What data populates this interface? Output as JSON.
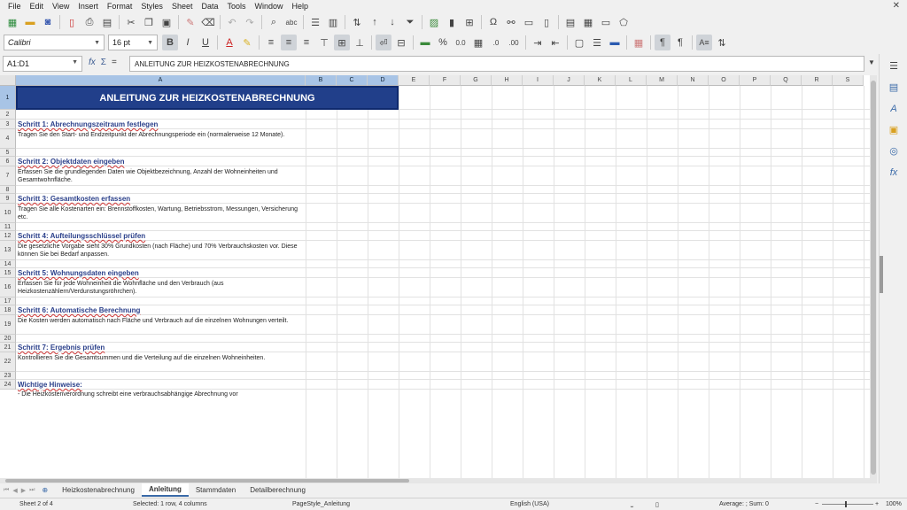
{
  "menu": [
    "File",
    "Edit",
    "View",
    "Insert",
    "Format",
    "Styles",
    "Sheet",
    "Data",
    "Tools",
    "Window",
    "Help"
  ],
  "font": {
    "name": "Calibri",
    "size": "16 pt"
  },
  "namebox": "A1:D1",
  "formula": "ANLEITUNG ZUR HEIZKOSTENABRECHNUNG",
  "columns": [
    "A",
    "B",
    "C",
    "D",
    "E",
    "F",
    "G",
    "H",
    "I",
    "J",
    "K",
    "L",
    "M",
    "N",
    "O",
    "P",
    "Q",
    "R",
    "S"
  ],
  "rows": [
    "1",
    "2",
    "3",
    "4",
    "5",
    "6",
    "7",
    "8",
    "9",
    "10",
    "11",
    "12",
    "13",
    "14",
    "15",
    "16",
    "17",
    "18",
    "19",
    "20",
    "21",
    "22",
    "23",
    "24"
  ],
  "title": "ANLEITUNG ZUR HEIZKOSTENABRECHNUNG",
  "steps": [
    {
      "head": "Schritt 1: Abrechnungszeitraum festlegen",
      "desc": "Tragen Sie den Start- und Endzeitpunkt der Abrechnungsperiode ein (normalerweise 12 Monate)."
    },
    {
      "head": "Schritt 2: Objektdaten eingeben",
      "desc": "Erfassen Sie die grundlegenden Daten wie Objektbezeichnung, Anzahl der Wohneinheiten und Gesamtwohnfläche."
    },
    {
      "head": "Schritt 3: Gesamtkosten erfassen",
      "desc": "Tragen Sie alle Kostenarten ein: Brennstoffkosten, Wartung, Betriebsstrom, Messungen, Versicherung etc."
    },
    {
      "head": "Schritt 4: Aufteilungsschlüssel prüfen",
      "desc": "Die gesetzliche Vorgabe sieht 30% Grundkosten (nach Fläche) und 70% Verbrauchskosten vor. Diese können Sie bei Bedarf anpassen."
    },
    {
      "head": "Schritt 5: Wohnungsdaten eingeben",
      "desc": "Erfassen Sie für jede Wohneinheit die Wohnfläche und den Verbrauch (aus Heizkostenzählern/Verdunstungsröhrchen)."
    },
    {
      "head": "Schritt 6: Automatische Berechnung",
      "desc": "Die Kosten werden automatisch nach Fläche und Verbrauch auf die einzelnen Wohnungen verteilt."
    },
    {
      "head": "Schritt 7: Ergebnis prüfen",
      "desc": "Kontrollieren Sie die Gesamtsummen und die Verteilung auf die einzelnen Wohneinheiten."
    }
  ],
  "notes": {
    "head": "Wichtige Hinweise:",
    "line1": "- Die Heizkostenverordnung schreibt eine verbrauchsabhängige Abrechnung vor"
  },
  "tabs": [
    "Heizkostenabrechnung",
    "Anleitung",
    "Stammdaten",
    "Detailberechnung"
  ],
  "active_tab": "Anleitung",
  "status": {
    "sheet": "Sheet 2 of 4",
    "selection": "Selected: 1 row, 4 columns",
    "pagestyle": "PageStyle_Anleitung",
    "language": "English (USA)",
    "summary": "Average: ; Sum: 0",
    "zoom": "100%"
  }
}
